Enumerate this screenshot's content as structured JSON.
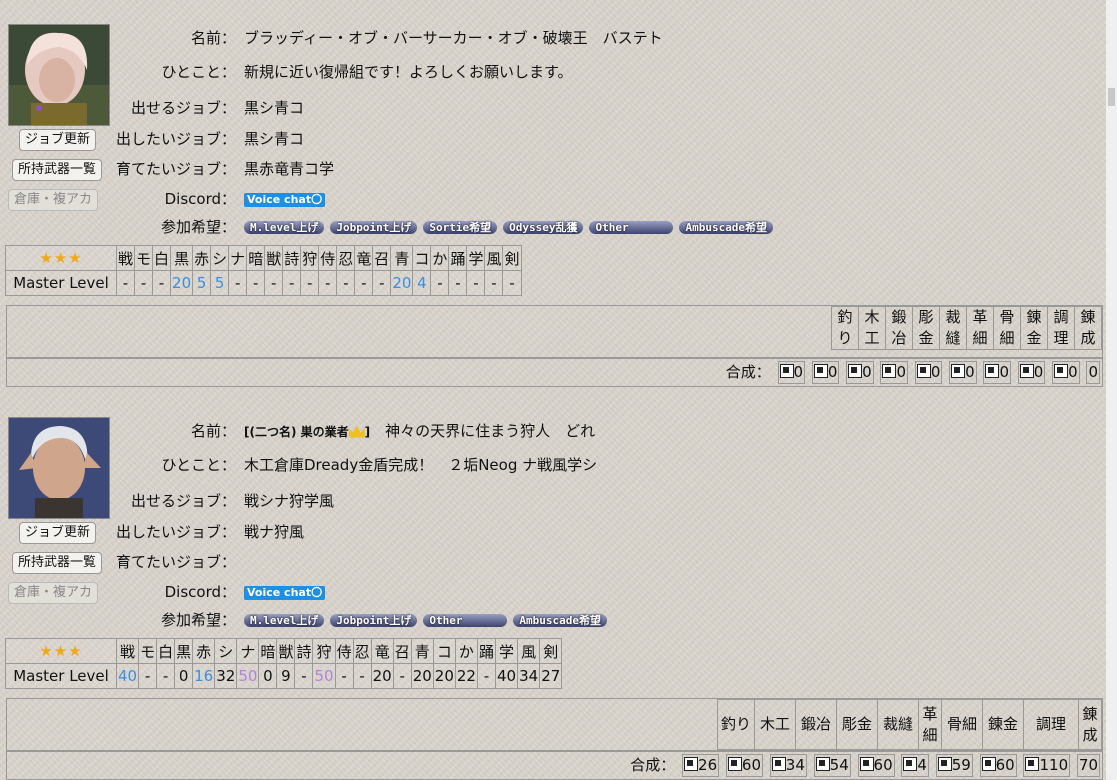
{
  "profiles": [
    {
      "avatar_icon": "elvaan-avatar",
      "buttons": {
        "job_update": "ジョブ更新",
        "weapons": "所持武器一覧",
        "storage": "倉庫・複アカ"
      },
      "fields": {
        "name_label": "名前：",
        "name": "ブラッディー・オブ・バーサーカー・オブ・破壊王　バステト",
        "comment_label": "ひとこと：",
        "comment": "新規に近い復帰組です！よろしくお願いします。",
        "can_job_label": "出せるジョブ：",
        "can_job": "黒シ青コ",
        "want_job_label": "出したいジョブ：",
        "want_job": "黒シ青コ",
        "grow_job_label": "育てたいジョブ：",
        "grow_job": "黒赤竜青コ学",
        "discord_label": "Discord：",
        "discord": "Voice chat〇",
        "join_label": "参加希望：",
        "tags": [
          "M.level上げ",
          "Jobpoint上げ",
          "Sortie希望",
          "Odyssey乱獲",
          "Other",
          "Ambuscade希望"
        ]
      },
      "master_stars": "★★★",
      "master_label": "Master Level",
      "jobs": [
        "戦",
        "モ",
        "白",
        "黒",
        "赤",
        "シ",
        "ナ",
        "暗",
        "獣",
        "詩",
        "狩",
        "侍",
        "忍",
        "竜",
        "召",
        "青",
        "コ",
        "か",
        "踊",
        "学",
        "風",
        "剣"
      ],
      "levels": [
        "-",
        "-",
        "-",
        "20",
        "5",
        "5",
        "-",
        "-",
        "-",
        "-",
        "-",
        "-",
        "-",
        "-",
        "-",
        "20",
        "4",
        "-",
        "-",
        "-",
        "-",
        "-"
      ],
      "crafts": [
        "釣り",
        "木工",
        "鍛冶",
        "彫金",
        "裁縫",
        "革細",
        "骨細",
        "錬金",
        "調理",
        "錬成"
      ],
      "craft_sum_label": "合成：",
      "craft_values": [
        "0",
        "0",
        "0",
        "0",
        "0",
        "0",
        "0",
        "0",
        "0",
        "0"
      ]
    },
    {
      "avatar_icon": "elvaan-avatar",
      "buttons": {
        "job_update": "ジョブ更新",
        "weapons": "所持武器一覧",
        "storage": "倉庫・複アカ"
      },
      "fields": {
        "name_label": "名前：",
        "title": "[(二つ名) 巣の業者",
        "title_end": "]",
        "name": "神々の天界に住まう狩人　どれ",
        "comment_label": "ひとこと：",
        "comment": "木工倉庫Dready金盾完成！　２垢Neog ナ戦風学シ",
        "can_job_label": "出せるジョブ：",
        "can_job": "戦シナ狩学風",
        "want_job_label": "出したいジョブ：",
        "want_job": "戦ナ狩風",
        "grow_job_label": "育てたいジョブ：",
        "grow_job": "",
        "discord_label": "Discord：",
        "discord": "Voice chat〇",
        "join_label": "参加希望：",
        "tags": [
          "M.level上げ",
          "Jobpoint上げ",
          "Other",
          "Ambuscade希望"
        ]
      },
      "master_stars": "★★★",
      "master_label": "Master Level",
      "jobs": [
        "戦",
        "モ",
        "白",
        "黒",
        "赤",
        "シ",
        "ナ",
        "暗",
        "獣",
        "詩",
        "狩",
        "侍",
        "忍",
        "竜",
        "召",
        "青",
        "コ",
        "か",
        "踊",
        "学",
        "風",
        "剣"
      ],
      "levels": [
        "40",
        "-",
        "-",
        "0",
        "16",
        "32",
        "50",
        "0",
        "9",
        "-",
        "50",
        "-",
        "-",
        "20",
        "-",
        "20",
        "20",
        "22",
        "-",
        "40",
        "34",
        "27"
      ],
      "crafts": [
        "釣り",
        "木工",
        "鍛冶",
        "彫金",
        "裁縫",
        "革細",
        "骨細",
        "錬金",
        "調理",
        "錬成"
      ],
      "craft_sum_label": "合成：",
      "craft_values": [
        "26",
        "60",
        "34",
        "54",
        "60",
        "4",
        "59",
        "60",
        "110",
        "70"
      ]
    }
  ],
  "colors": {
    "level_blue": "#3b8ee0",
    "level_purple": "#b083d8",
    "star": "#f0a818",
    "voice_bg": "#1c8fe6"
  }
}
